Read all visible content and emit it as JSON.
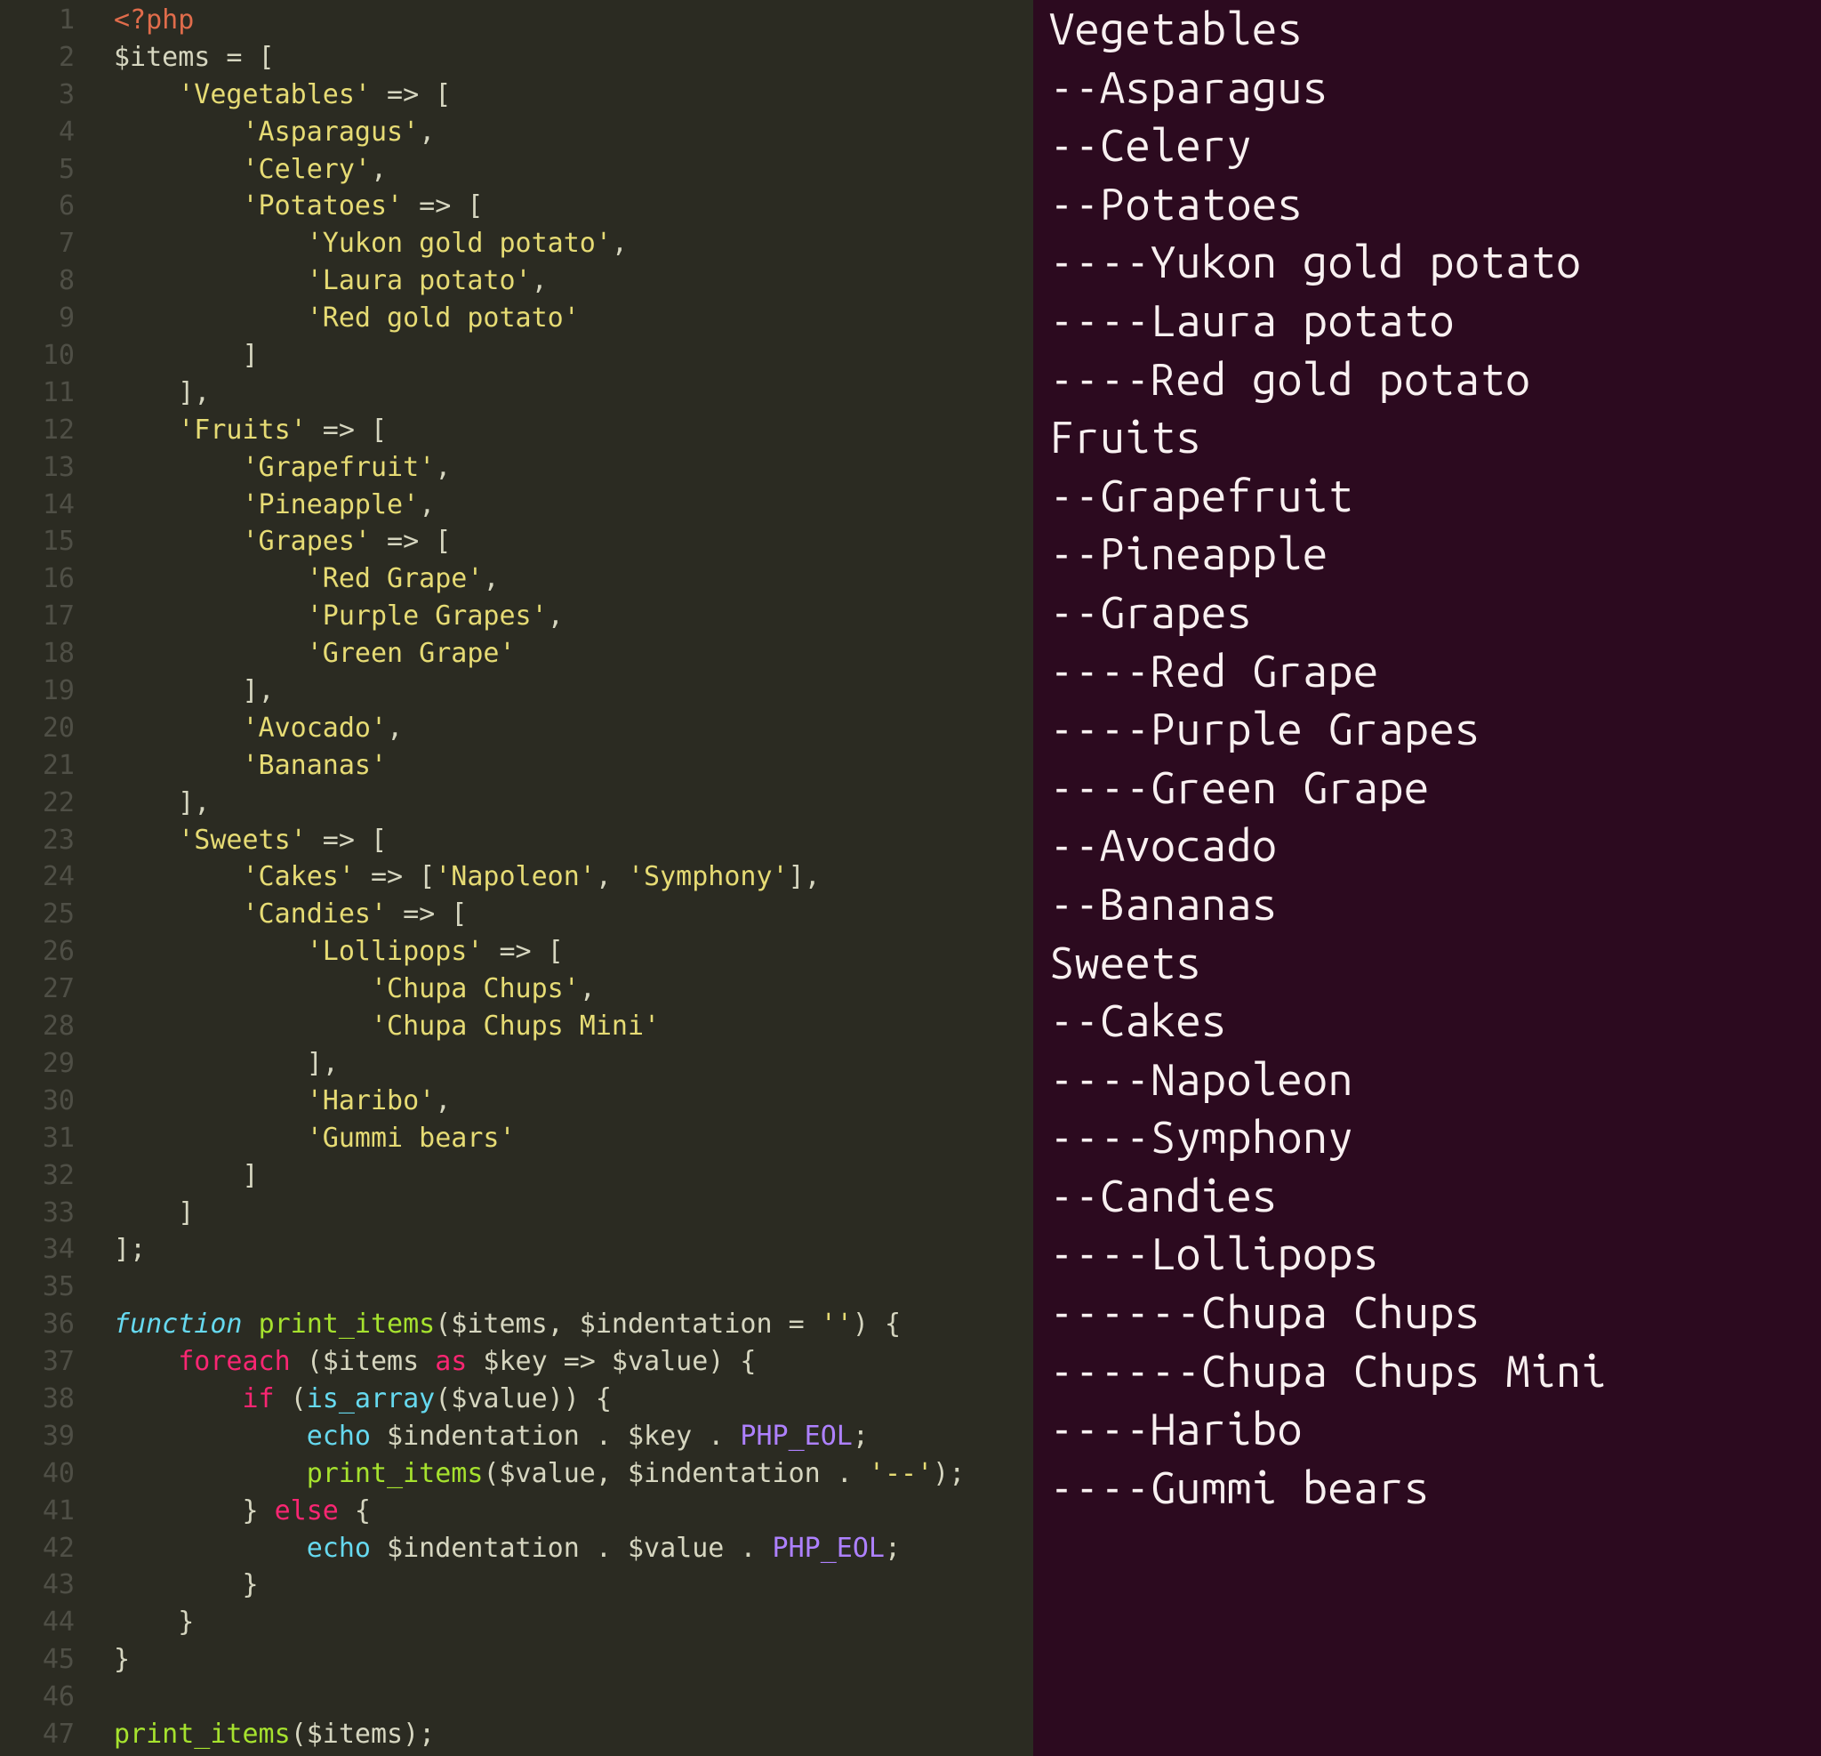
{
  "editor": {
    "lines": [
      "1",
      "2",
      "3",
      "4",
      "5",
      "6",
      "7",
      "8",
      "9",
      "10",
      "11",
      "12",
      "13",
      "14",
      "15",
      "16",
      "17",
      "18",
      "19",
      "20",
      "21",
      "22",
      "23",
      "24",
      "25",
      "26",
      "27",
      "28",
      "29",
      "30",
      "31",
      "32",
      "33",
      "34",
      "35",
      "36",
      "37",
      "38",
      "39",
      "40",
      "41",
      "42",
      "43",
      "44",
      "45",
      "46",
      "47"
    ],
    "code": [
      {
        "t": "tag",
        "v": "<?php"
      },
      {
        "t": "arr_open",
        "indent": 0,
        "var": "$items",
        "eq": " = ["
      },
      {
        "t": "key_open",
        "indent": 1,
        "key": "'Vegetables'",
        "arrow": " => ["
      },
      {
        "t": "str",
        "indent": 2,
        "v": "'Asparagus'",
        "comma": true
      },
      {
        "t": "str",
        "indent": 2,
        "v": "'Celery'",
        "comma": true
      },
      {
        "t": "key_open",
        "indent": 2,
        "key": "'Potatoes'",
        "arrow": " => ["
      },
      {
        "t": "str",
        "indent": 3,
        "v": "'Yukon gold potato'",
        "comma": true
      },
      {
        "t": "str",
        "indent": 3,
        "v": "'Laura potato'",
        "comma": true
      },
      {
        "t": "str",
        "indent": 3,
        "v": "'Red gold potato'",
        "comma": false
      },
      {
        "t": "close",
        "indent": 2,
        "v": "]"
      },
      {
        "t": "close",
        "indent": 1,
        "v": "],"
      },
      {
        "t": "key_open",
        "indent": 1,
        "key": "'Fruits'",
        "arrow": " => ["
      },
      {
        "t": "str",
        "indent": 2,
        "v": "'Grapefruit'",
        "comma": true
      },
      {
        "t": "str",
        "indent": 2,
        "v": "'Pineapple'",
        "comma": true
      },
      {
        "t": "key_open",
        "indent": 2,
        "key": "'Grapes'",
        "arrow": " => ["
      },
      {
        "t": "str",
        "indent": 3,
        "v": "'Red Grape'",
        "comma": true
      },
      {
        "t": "str",
        "indent": 3,
        "v": "'Purple Grapes'",
        "comma": true
      },
      {
        "t": "str",
        "indent": 3,
        "v": "'Green Grape'",
        "comma": false
      },
      {
        "t": "close",
        "indent": 2,
        "v": "],"
      },
      {
        "t": "str",
        "indent": 2,
        "v": "'Avocado'",
        "comma": true
      },
      {
        "t": "str",
        "indent": 2,
        "v": "'Bananas'",
        "comma": false
      },
      {
        "t": "close",
        "indent": 1,
        "v": "],"
      },
      {
        "t": "key_open",
        "indent": 1,
        "key": "'Sweets'",
        "arrow": " => ["
      },
      {
        "t": "inline",
        "indent": 2,
        "key": "'Cakes'",
        "vals": [
          "'Napoleon'",
          "'Symphony'"
        ]
      },
      {
        "t": "key_open",
        "indent": 2,
        "key": "'Candies'",
        "arrow": " => ["
      },
      {
        "t": "key_open",
        "indent": 3,
        "key": "'Lollipops'",
        "arrow": " => ["
      },
      {
        "t": "str",
        "indent": 4,
        "v": "'Chupa Chups'",
        "comma": true
      },
      {
        "t": "str",
        "indent": 4,
        "v": "'Chupa Chups Mini'",
        "comma": false
      },
      {
        "t": "close",
        "indent": 3,
        "v": "],"
      },
      {
        "t": "str",
        "indent": 3,
        "v": "'Haribo'",
        "comma": true
      },
      {
        "t": "str",
        "indent": 3,
        "v": "'Gummi bears'",
        "comma": false
      },
      {
        "t": "close",
        "indent": 2,
        "v": "]"
      },
      {
        "t": "close",
        "indent": 1,
        "v": "]"
      },
      {
        "t": "close",
        "indent": 0,
        "v": "];"
      },
      {
        "t": "blank"
      },
      {
        "t": "func_sig",
        "indent": 0
      },
      {
        "t": "foreach",
        "indent": 1
      },
      {
        "t": "if",
        "indent": 2
      },
      {
        "t": "echo_key",
        "indent": 3
      },
      {
        "t": "recurse",
        "indent": 3
      },
      {
        "t": "else",
        "indent": 2
      },
      {
        "t": "echo_val",
        "indent": 3
      },
      {
        "t": "brace",
        "indent": 2,
        "v": "}"
      },
      {
        "t": "brace",
        "indent": 1,
        "v": "}"
      },
      {
        "t": "brace",
        "indent": 0,
        "v": "}"
      },
      {
        "t": "blank"
      },
      {
        "t": "call_print",
        "indent": 0
      }
    ],
    "tokens": {
      "function": "function",
      "print_items": "print_items",
      "params": "($items, $indentation = ",
      "empty": "''",
      "foreach": "foreach",
      "foreach_rest": " ($items ",
      "as": "as",
      "kv": " $key => $value) {",
      "if": "if",
      "is_array": "is_array",
      "val_paren": "($value)) {",
      "echo": "echo",
      "indent_key": " $indentation . $key . ",
      "php_eol": "PHP_EOL",
      "semi": ";",
      "recurse_args": "($value, $indentation . ",
      "dashes": "'--'",
      "else": "else",
      "indent_val": " $indentation . $value . ",
      "call": "print_items",
      "call_arg": "($items);"
    }
  },
  "terminal": {
    "lines": [
      "Vegetables",
      "--Asparagus",
      "--Celery",
      "--Potatoes",
      "----Yukon gold potato",
      "----Laura potato",
      "----Red gold potato",
      "Fruits",
      "--Grapefruit",
      "--Pineapple",
      "--Grapes",
      "----Red Grape",
      "----Purple Grapes",
      "----Green Grape",
      "--Avocado",
      "--Bananas",
      "Sweets",
      "--Cakes",
      "----Napoleon",
      "----Symphony",
      "--Candies",
      "----Lollipops",
      "------Chupa Chups",
      "------Chupa Chups Mini",
      "----Haribo",
      "----Gummi bears"
    ]
  }
}
